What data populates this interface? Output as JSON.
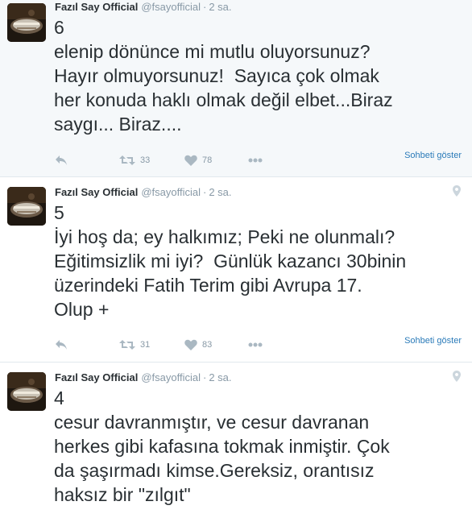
{
  "tweets": [
    {
      "fullname": "Fazıl Say Official",
      "username": "@fsayofficial",
      "separator": "·",
      "time": "2 sa.",
      "text": "6\nelenip dönünce mi mutlu oluyorsunuz?\nHayır olmuyorsunuz!  Sayıca çok olmak\nher konuda haklı olmak değil elbet...Biraz\nsaygı... Biraz....",
      "retweets": "33",
      "likes": "78",
      "conversation_label": "Sohbeti göster"
    },
    {
      "fullname": "Fazıl Say Official",
      "username": "@fsayofficial",
      "separator": "·",
      "time": "2 sa.",
      "text": "5\nİyi hoş da; ey halkımız; Peki ne olunmalı?\nEğitimsizlik mi iyi?  Günlük kazancı 30binin\nüzerindeki Fatih Terim gibi Avrupa 17.\nOlup +",
      "retweets": "31",
      "likes": "83",
      "conversation_label": "Sohbeti göster"
    },
    {
      "fullname": "Fazıl Say Official",
      "username": "@fsayofficial",
      "separator": "·",
      "time": "2 sa.",
      "text": "4\ncesur davranmıştır, ve cesur davranan\nherkes gibi kafasına tokmak inmiştir. Çok\nda şaşırmadı kimse.Gereksiz, orantısız\nhaksız bir \"zılgıt\""
    }
  ],
  "colors": {
    "link": "#2b7bb9",
    "muted": "#8899a6",
    "icon": "#aab8c2",
    "text": "#292f33",
    "highlight_bg": "#f5f8fa"
  },
  "icons": [
    "reply-icon",
    "retweet-icon",
    "heart-icon",
    "more-icon",
    "location-pin-icon"
  ]
}
